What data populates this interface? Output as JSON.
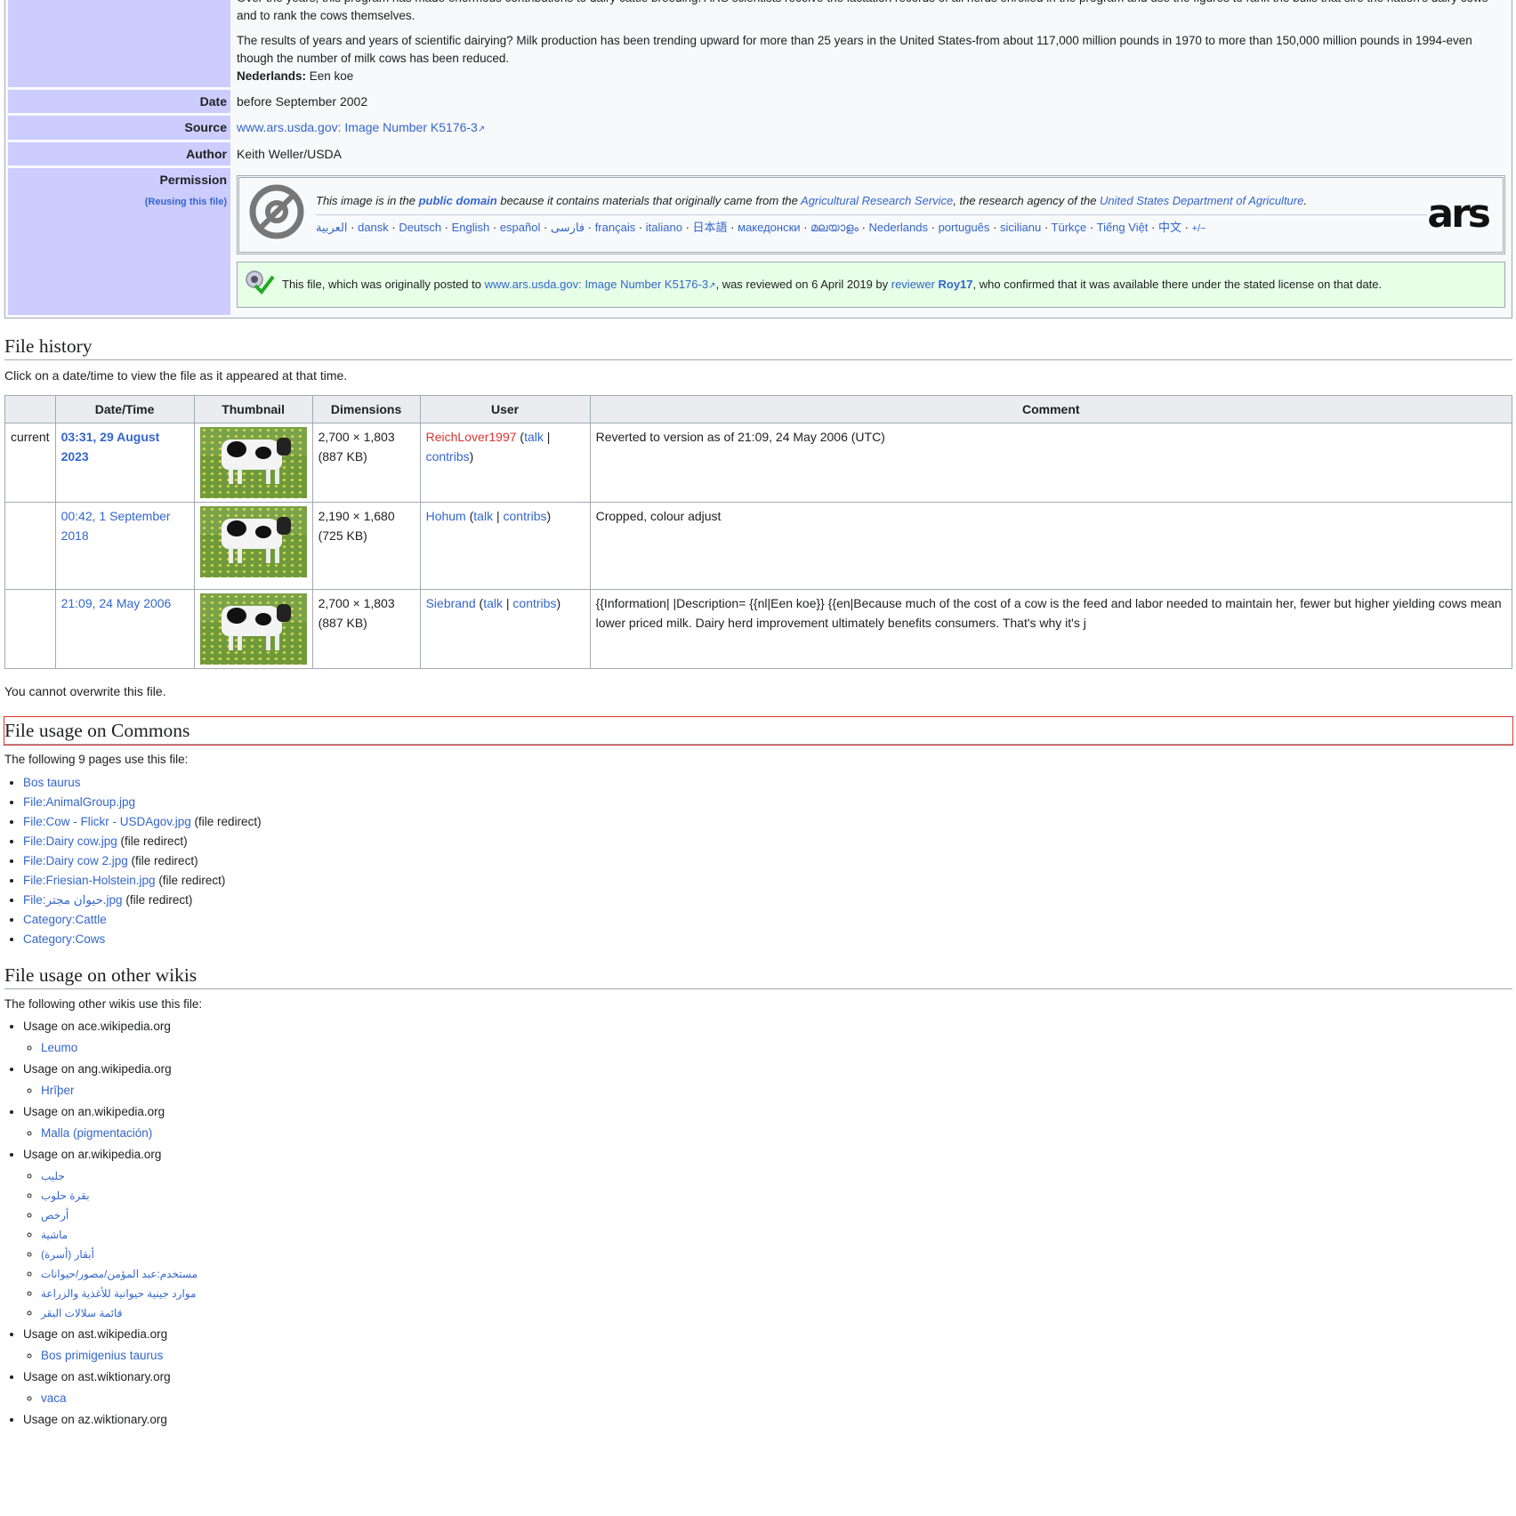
{
  "info": {
    "desc_para1": "Over the years, this program has made enormous contributions to dairy cattle breeding. ARS scientists receive the lactation records of all herds enrolled in the program and use the figures to rank the bulls that sire the nation's dairy cows and to rank the cows themselves.",
    "desc_para2": "The results of years and years of scientific dairying? Milk production has been trending upward for more than 25 years in the United States-from about 117,000 million pounds in 1970 to more than 150,000 million pounds in 1994-even though the number of milk cows has been reduced.",
    "nl_label": "Nederlands:",
    "nl_text": " Een koe",
    "date_label": "Date",
    "date_value": "before September 2002",
    "source_label": "Source",
    "source_link": "www.ars.usda.gov: Image Number K5176-3",
    "author_label": "Author",
    "author_value": "Keith Weller/USDA",
    "permission_label": "Permission",
    "reusing_link": "(Reusing this file)"
  },
  "pd": {
    "s1": "This image is in the ",
    "public_domain": "public domain",
    "s2": " because it contains materials that originally came from the ",
    "ars_link": "Agricultural Research Service",
    "s3": ", the research agency of the ",
    "usda_link": "United States Department of Agriculture",
    "s4": ".",
    "languages": [
      "العربية",
      "dansk",
      "Deutsch",
      "English",
      "español",
      "فارسی",
      "français",
      "italiano",
      "日本語",
      "македонски",
      "മലയാളം",
      "Nederlands",
      "português",
      "sicilianu",
      "Türkçe",
      "Tiếng Việt",
      "中文",
      "+/−"
    ],
    "logo_text": "ars"
  },
  "review": {
    "t1": "This file, which was originally posted to ",
    "link": "www.ars.usda.gov: Image Number K5176-3",
    "t2": ", was reviewed on 6 April 2019 by ",
    "reviewer": "reviewer",
    "reviewer_name": "Roy17",
    "t3": ", who confirmed that it was available there under the stated license on that date."
  },
  "history": {
    "heading": "File history",
    "intro": "Click on a date/time to view the file as it appeared at that time.",
    "columns": [
      "",
      "Date/Time",
      "Thumbnail",
      "Dimensions",
      "User",
      "Comment"
    ],
    "rows": [
      {
        "current": "current",
        "date": "03:31, 29 August 2023",
        "dims": "2,700 × 1,803",
        "size": "(887 KB)",
        "user": "ReichLover1997",
        "user_red": true,
        "talk": "talk",
        "contribs": "contribs",
        "comment": "Reverted to version as of 21:09, 24 May 2006 (UTC)"
      },
      {
        "current": "",
        "date": "00:42, 1 September 2018",
        "dims": "2,190 × 1,680",
        "size": "(725 KB)",
        "user": "Hohum",
        "user_red": false,
        "talk": "talk",
        "contribs": "contribs",
        "comment": "Cropped, colour adjust"
      },
      {
        "current": "",
        "date": "21:09, 24 May 2006",
        "dims": "2,700 × 1,803",
        "size": "(887 KB)",
        "user": "Siebrand",
        "user_red": false,
        "talk": "talk",
        "contribs": "contribs",
        "comment": "{{Information| |Description= {{nl|Een koe}} {{en|Because much of the cost of a cow is the feed and labor needed to maintain her, fewer but higher yielding cows mean lower priced milk. Dairy herd improvement ultimately benefits consumers. That's why it's j"
      }
    ],
    "overwrite_note": "You cannot overwrite this file."
  },
  "usage_commons": {
    "heading": "File usage on Commons",
    "intro": "The following 9 pages use this file:",
    "items": [
      {
        "link": "Bos taurus",
        "note": ""
      },
      {
        "link": "File:AnimalGroup.jpg",
        "note": ""
      },
      {
        "link": "File:Cow - Flickr - USDAgov.jpg",
        "note": " (file redirect)"
      },
      {
        "link": "File:Dairy cow.jpg",
        "note": " (file redirect)"
      },
      {
        "link": "File:Dairy cow 2.jpg",
        "note": " (file redirect)"
      },
      {
        "link": "File:Friesian-Holstein.jpg",
        "note": " (file redirect)"
      },
      {
        "link": "File:حيوان مجتر.jpg",
        "note": " (file redirect)"
      },
      {
        "link": "Category:Cattle",
        "note": ""
      },
      {
        "link": "Category:Cows",
        "note": ""
      }
    ]
  },
  "usage_other": {
    "heading": "File usage on other wikis",
    "intro": "The following other wikis use this file:",
    "wikis": [
      {
        "label": "Usage on ace.wikipedia.org",
        "pages": [
          "Leumo"
        ]
      },
      {
        "label": "Usage on ang.wikipedia.org",
        "pages": [
          "Hrīþer"
        ]
      },
      {
        "label": "Usage on an.wikipedia.org",
        "pages": [
          "Malla (pigmentación)"
        ]
      },
      {
        "label": "Usage on ar.wikipedia.org",
        "pages": [
          "حليب",
          "بقرة حلوب",
          "أرخص",
          "ماشية",
          "أبقار (أسرة)",
          "مستخدم:عبد المؤمن/مصور/حيوانات",
          "موارد جينية حيوانية للأغذية والزراعة",
          "قائمة سلالات البقر"
        ]
      },
      {
        "label": "Usage on ast.wikipedia.org",
        "pages": [
          "Bos primigenius taurus"
        ]
      },
      {
        "label": "Usage on ast.wiktionary.org",
        "pages": [
          "vaca"
        ]
      },
      {
        "label": "Usage on az.wiktionary.org",
        "pages": []
      }
    ]
  },
  "colors": {
    "link": "#3366cc",
    "redlink": "#d33",
    "label_bg": "#ccccff",
    "review_bg": "#e6ffe6"
  },
  "icons": [
    "pd-icon",
    "external-link-icon",
    "review-check-icon"
  ]
}
